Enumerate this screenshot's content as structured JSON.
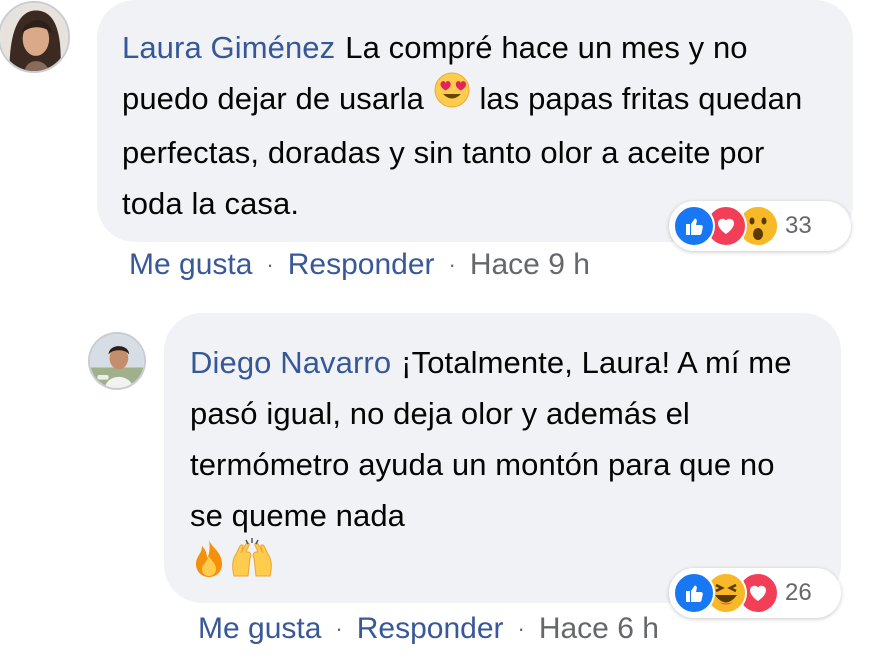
{
  "comments": [
    {
      "author": "Laura Giménez",
      "text_1": "La compré hace un mes y no puedo dejar de usarla",
      "emoji_1": "heart-eyes-emoji",
      "text_2": "las papas fritas quedan perfectas, doradas y sin tanto olor a aceite por toda la casa.",
      "reactions": [
        "like",
        "love",
        "wow"
      ],
      "reaction_count": "33",
      "like_label": "Me gusta",
      "reply_label": "Responder",
      "time": "Hace 9 h",
      "separator": "·"
    },
    {
      "author": "Diego Navarro",
      "text_1": "¡Totalmente, Laura! A mí me pasó igual, no deja olor y además el termómetro ayuda un montón para que no se queme nada",
      "emojis": [
        "fire-emoji",
        "raising-hands-emoji"
      ],
      "reactions": [
        "like",
        "haha",
        "love"
      ],
      "reaction_count": "26",
      "like_label": "Me gusta",
      "reply_label": "Responder",
      "time": "Hace 6 h",
      "separator": "·"
    }
  ],
  "colors": {
    "bubble": "#f0f2f5",
    "author": "#365899",
    "link": "#385898",
    "meta": "#65676b",
    "like": "#1877f2",
    "love": "#f33e58",
    "wow": "#f7b928"
  }
}
